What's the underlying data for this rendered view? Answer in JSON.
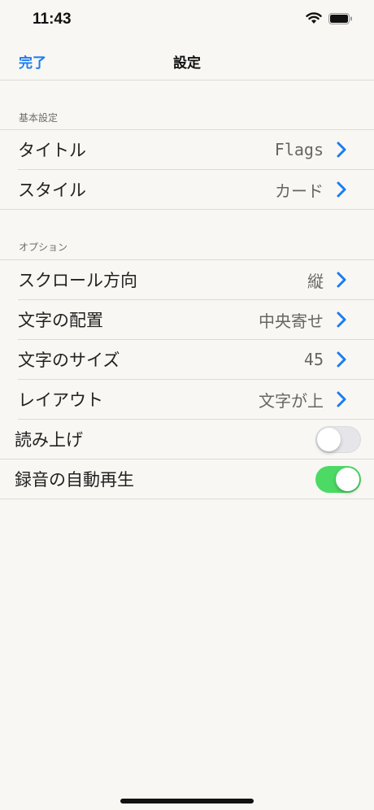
{
  "status": {
    "time": "11:43"
  },
  "nav": {
    "done_label": "完了",
    "title": "設定"
  },
  "sections": {
    "basic": {
      "header": "基本設定",
      "rows": [
        {
          "label": "タイトル",
          "value": "Flags"
        },
        {
          "label": "スタイル",
          "value": "カード"
        }
      ]
    },
    "options": {
      "header": "オプション",
      "rows": [
        {
          "label": "スクロール方向",
          "value": "縦"
        },
        {
          "label": "文字の配置",
          "value": "中央寄せ"
        },
        {
          "label": "文字のサイズ",
          "value": "45"
        },
        {
          "label": "レイアウト",
          "value": "文字が上"
        }
      ],
      "toggles": [
        {
          "label": "読み上げ",
          "on": false
        },
        {
          "label": "録音の自動再生",
          "on": true
        }
      ]
    }
  },
  "colors": {
    "accent": "#1b7cf0",
    "toggle_on": "#4cd964",
    "background": "#f8f7f3"
  }
}
